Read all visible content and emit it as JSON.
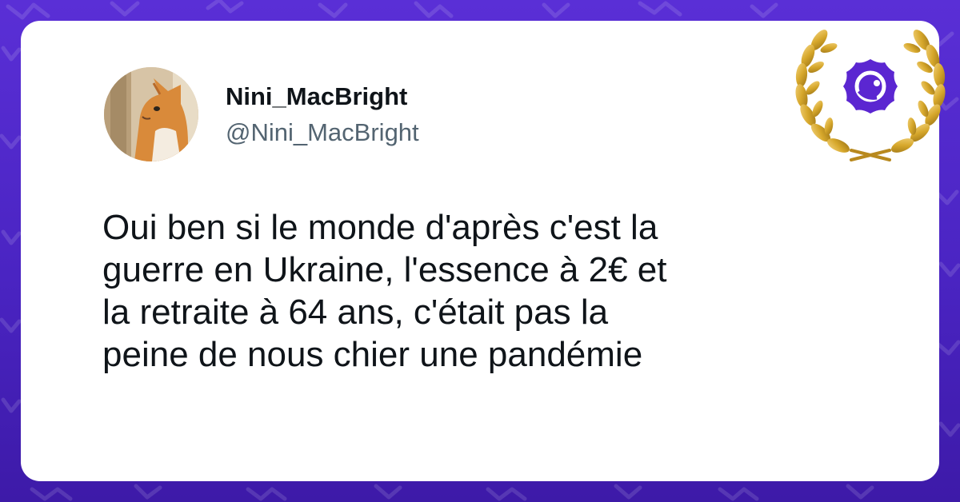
{
  "tweet": {
    "author": {
      "display_name": "Nini_MacBright",
      "handle": "@Nini_MacBright",
      "avatar_icon": "cat-avatar"
    },
    "lines": [
      "Oui ben si le monde d'après c'est la",
      "guerre en Ukraine, l'essence à 2€ et",
      "la retraite à 64 ans, c'était pas la",
      "peine de nous chier une pandémie"
    ]
  },
  "badge": {
    "icon": "laurel-wreath-logo-icon",
    "colors": {
      "wreath": "#d6a72b",
      "logo": "#5b26d1"
    }
  },
  "colors": {
    "background": "#4d26c7",
    "card": "#ffffff",
    "text": "#0f1419",
    "handle": "#536471"
  }
}
